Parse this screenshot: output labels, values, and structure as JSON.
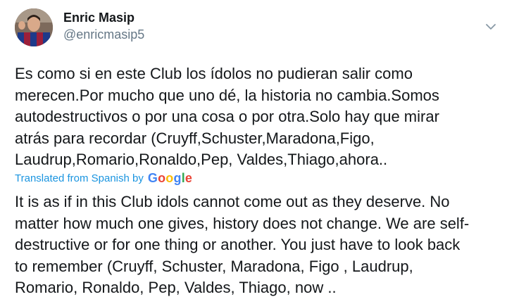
{
  "author": {
    "name": "Enric Masip",
    "handle": "@enricmasip5"
  },
  "tweet": {
    "text": "Es como si en este Club los ídolos no pudieran salir como\nmerecen.Por mucho que uno dé, la historia no cambia.Somos\nautodestructivos o por una cosa o por otra.Solo hay que mirar\natrás para recordar (Cruyff,Schuster,Maradona,Figo,\nLaudrup,Romario,Ronaldo,Pep, Valdes,Thiago,ahora.."
  },
  "translation": {
    "label": "Translated from Spanish by",
    "provider": "Google",
    "text": "It is as if in this Club idols cannot come out as they deserve. No\nmatter how much one gives, history does not change. We are self-\ndestructive or for one thing or another. You just have to look back\nto remember (Cruyff, Schuster, Maradona, Figo , Laudrup,\nRomario, Ronaldo, Pep, Valdes, Thiago, now .."
  },
  "icons": {
    "menu": "chevron-down-icon",
    "avatar": "profile-photo"
  },
  "colors": {
    "link_blue": "#1b95e0",
    "secondary_text": "#657786",
    "primary_text": "#14171a"
  }
}
